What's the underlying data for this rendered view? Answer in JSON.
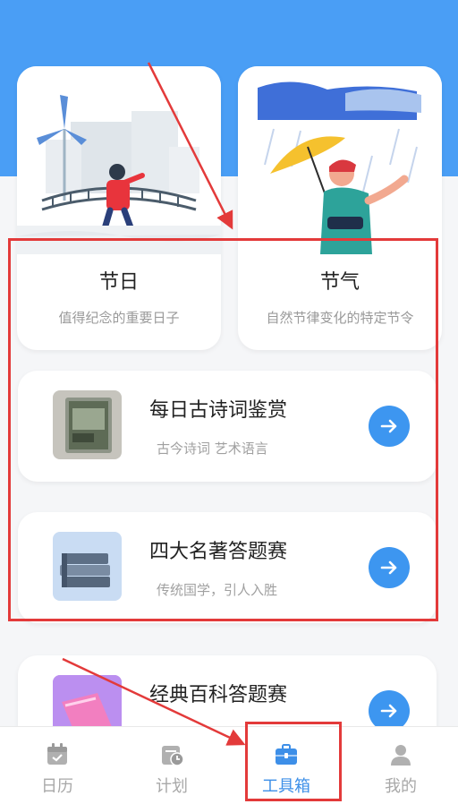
{
  "cards": {
    "festival": {
      "title": "节日",
      "subtitle": "值得纪念的重要日子"
    },
    "solar_term": {
      "title": "节气",
      "subtitle": "自然节律变化的特定节令"
    }
  },
  "list": [
    {
      "title": "每日古诗词鉴赏",
      "subtitle": "古今诗词 艺术语言",
      "action_icon": "arrow-right-icon"
    },
    {
      "title": "四大名著答题赛",
      "subtitle": "传统国学，引人入胜",
      "action_icon": "arrow-right-icon"
    },
    {
      "title": "经典百科答题赛",
      "subtitle": "",
      "action_icon": "arrow-right-icon"
    }
  ],
  "tabbar": {
    "tabs": [
      {
        "label": "日历",
        "icon": "calendar-icon"
      },
      {
        "label": "计划",
        "icon": "plan-clock-icon"
      },
      {
        "label": "工具箱",
        "icon": "toolbox-icon",
        "active": true
      },
      {
        "label": "我的",
        "icon": "person-icon"
      }
    ]
  },
  "colors": {
    "header": "#4a9ef5",
    "accent": "#3d96f0",
    "annotation": "#e33a3a"
  }
}
